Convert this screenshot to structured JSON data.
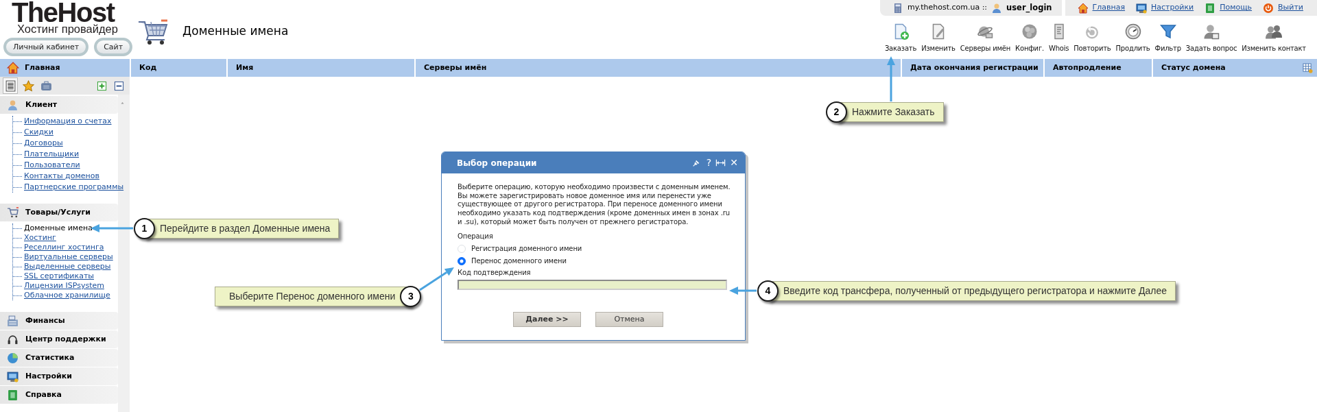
{
  "header": {
    "logo_title": "TheHost",
    "logo_subtitle": "Хостинг провайдер",
    "buttons": [
      "Личный кабинет",
      "Сайт"
    ],
    "page_title": "Доменные имена"
  },
  "user_bar": {
    "host": "my.thehost.com.ua ::",
    "user": "user_login"
  },
  "top_links": [
    {
      "label": "Главная",
      "kind": "home"
    },
    {
      "label": "Настройки",
      "kind": "settings"
    },
    {
      "label": "Помощь",
      "kind": "help"
    },
    {
      "label": "Выйти",
      "kind": "logout"
    }
  ],
  "toolbar": [
    {
      "label": "Заказать",
      "kind": "order"
    },
    {
      "label": "Изменить",
      "kind": "edit"
    },
    {
      "label": "Серверы имён",
      "kind": "nameservers"
    },
    {
      "label": "Конфиг.",
      "kind": "config"
    },
    {
      "label": "Whois",
      "kind": "whois"
    },
    {
      "label": "Повторить",
      "kind": "repeat"
    },
    {
      "label": "Продлить",
      "kind": "renew"
    },
    {
      "label": "Фильтр",
      "kind": "filter"
    },
    {
      "label": "Задать вопрос",
      "kind": "ask"
    },
    {
      "label": "Изменить контакт",
      "kind": "contact"
    }
  ],
  "nav_home": "Главная",
  "table": {
    "columns": [
      "Код",
      "Имя",
      "Серверы имён",
      "Дата окончания регистрации",
      "Автопродление",
      "Статус домена"
    ]
  },
  "sidebar": {
    "tabs": [
      {
        "kind": "list",
        "selected": true
      },
      {
        "kind": "favorites",
        "selected": false
      },
      {
        "kind": "services",
        "selected": false
      }
    ],
    "sections": [
      {
        "title": "Клиент",
        "kind": "client",
        "items": [
          {
            "label": "Информация о счетах",
            "selected": false
          },
          {
            "label": "Скидки",
            "selected": false
          },
          {
            "label": "Договоры",
            "selected": false
          },
          {
            "label": "Плательщики",
            "selected": false
          },
          {
            "label": "Пользователи",
            "selected": false
          },
          {
            "label": "Контакты доменов",
            "selected": false
          },
          {
            "label": "Партнерские программы",
            "selected": false
          }
        ]
      },
      {
        "title": "Товары/Услуги",
        "kind": "cart",
        "items": [
          {
            "label": "Доменные имена",
            "selected": true
          },
          {
            "label": "Хостинг",
            "selected": false
          },
          {
            "label": "Реселлинг хостинга",
            "selected": false
          },
          {
            "label": "Виртуальные серверы",
            "selected": false
          },
          {
            "label": "Выделенные серверы",
            "selected": false
          },
          {
            "label": "SSL сертификаты",
            "selected": false
          },
          {
            "label": "Лицензии ISPsystem",
            "selected": false
          },
          {
            "label": "Облачное хранилище",
            "selected": false
          }
        ]
      },
      {
        "title": "Финансы",
        "kind": "finance"
      },
      {
        "title": "Центр поддержки",
        "kind": "support"
      },
      {
        "title": "Статистика",
        "kind": "stats"
      },
      {
        "title": "Настройки",
        "kind": "settings"
      },
      {
        "title": "Справка",
        "kind": "help"
      }
    ]
  },
  "dialog": {
    "title": "Выбор операции",
    "title_glyphs": [
      "?",
      "✕"
    ],
    "text": "Выберите операцию, которую необходимо произвести с доменным именем. Вы можете зарегистрировать новое доменное имя или перенести уже существующее от другого регистратора. При переносе доменного имени необходимо указать код подтверждения (кроме доменных имен в зонах .ru и .su), который может быть получен от прежнего регистратора.",
    "operation_label": "Операция",
    "options": [
      {
        "label": "Регистрация доменного имени",
        "selected": false
      },
      {
        "label": "Перенос доменного имени",
        "selected": true
      }
    ],
    "code_label": "Код подтверждения",
    "buttons": [
      {
        "label": "Далее >>",
        "kind": "primary"
      },
      {
        "label": "Отмена",
        "kind": "secondary"
      }
    ]
  },
  "callouts": [
    {
      "number": "1",
      "text": "Перейдите в раздел Доменные имена"
    },
    {
      "number": "2",
      "text": "Нажмите Заказать"
    },
    {
      "number": "3",
      "text": "Выберите Перенос доменного имени"
    },
    {
      "number": "4",
      "text": "Введите код трансфера, полученный от предыдущего регистратора и нажмите Далее"
    }
  ]
}
